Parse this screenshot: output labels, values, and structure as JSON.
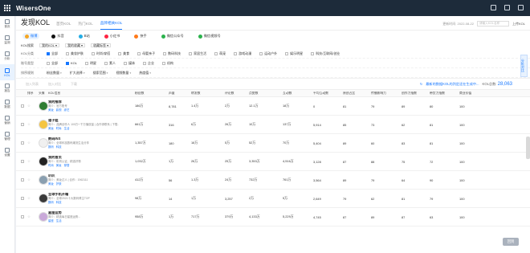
{
  "app": {
    "title": "WisersOne"
  },
  "sidebar": {
    "items": [
      {
        "label": "首页"
      },
      {
        "label": "监测"
      },
      {
        "label": "分析"
      },
      {
        "label": "KOL"
      },
      {
        "label": "报告"
      },
      {
        "label": "数据"
      },
      {
        "label": "营销"
      },
      {
        "label": "管理"
      },
      {
        "label": "设置"
      }
    ]
  },
  "header": {
    "title": "发现KOL",
    "tabs": [
      "首页KOL",
      "热门KOL",
      "品牌相关KOL"
    ],
    "updated": "更新时间: 2022-08-22",
    "search_placeholder": "请输入KOL名称",
    "export_label": "上传KOL"
  },
  "platforms": [
    "微博",
    "抖音",
    "B站",
    "小红书",
    "快手",
    "微信公众号",
    "微信视频号"
  ],
  "kol_row": {
    "label": "KOL搜索",
    "chips": [
      "我的KOL",
      "我的收藏",
      "收藏标签"
    ]
  },
  "filters": [
    {
      "label": "KOL分类",
      "options": [
        "全部",
        "美妆护肤",
        "时尚/穿搭",
        "美食",
        "母婴亲子",
        "数码科技",
        "家居生活",
        "萌宠",
        "游戏动漫",
        "运动户外",
        "娱乐明星",
        "科技/互联网/创业"
      ]
    },
    {
      "label": "账号类型",
      "options": [
        "全部",
        "KOL",
        "明星",
        "素人",
        "媒体",
        "企业",
        "机构"
      ]
    },
    {
      "label": "排序规则",
      "options": [
        "粉丝数量",
        "扩大选择",
        "搜索范围",
        "视频数量",
        "热度值"
      ]
    }
  ],
  "toolbar": {
    "actions": [
      "加入列表",
      "加入对比",
      "下载"
    ],
    "ai_label": "最新的数据KOL的判定还在生成中...",
    "count_label": "KOL总数:",
    "count": "28,063"
  },
  "table": {
    "headers": [
      "",
      "排序",
      "头像",
      "KOL信息",
      "粉丝数",
      "声量",
      "转发数",
      "评论数",
      "点赞数",
      "互动数",
      "平均互动数",
      "原创占比",
      "传播影响力",
      "创作力指数",
      "带货力指数",
      "商业价值"
    ],
    "rows": [
      {
        "name": "我的推荐",
        "desc": "简介：官方账号",
        "tags": [
          "美妆",
          "影视",
          "综艺"
        ],
        "fans": "186万",
        "vol": "8,781",
        "rt": "1.4万",
        "cm": "2万",
        "lk": "12.1万",
        "it": "18万",
        "avg": "0",
        "orig": "81",
        "spread": "79",
        "create": "89",
        "sell": "80",
        "biz": "100",
        "color": "#2e7d32"
      },
      {
        "name": "道子姐",
        "desc": "简介：品牌创作人 100万+ 千万播放量 | 合作请联系 | 下载...",
        "tags": [
          "美妆",
          "时尚",
          "生活"
        ],
        "fans": "661万",
        "vol": "316",
        "rt": "6万",
        "cm": "26万",
        "lk": "10万",
        "it": "137万",
        "avg": "5,914",
        "orig": "85",
        "spread": "73",
        "create": "62",
        "sell": "81",
        "biz": "100",
        "color": "#f5c542"
      },
      {
        "name": "数码INS",
        "desc": "简介：全球科技数码潮流生活分享",
        "tags": [
          "数码",
          "科技"
        ],
        "fans": "1,357万",
        "vol": "180",
        "rt": "16万",
        "cm": "5万",
        "lk": "52万",
        "it": "70万",
        "avg": "5,404",
        "orig": "89",
        "spread": "60",
        "create": "83",
        "sell": "81",
        "biz": "100",
        "color": "#f0f0f0"
      },
      {
        "name": "我的首页",
        "desc": "简介：机构认证，精选好物",
        "tags": [
          "时尚",
          "美妆",
          "穿搭"
        ],
        "fans": "1,032万",
        "vol": "1万",
        "rt": "26万",
        "cm": "25万",
        "lk": "3,353万",
        "it": "4,516万",
        "avg": "3,128",
        "orig": "87",
        "spread": "88",
        "create": "75",
        "sell": "72",
        "biz": "100",
        "color": "#222222"
      },
      {
        "name": "叭叭",
        "desc": "简介：美妆达人 | 合作：1962111",
        "tags": [
          "美妆",
          "护肤"
        ],
        "fans": "412万",
        "vol": "56",
        "rt": "1.3万",
        "cm": "24万",
        "lk": "732万",
        "it": "761万",
        "avg": "3,564",
        "orig": "89",
        "spread": "79",
        "create": "64",
        "sell": "90",
        "biz": "100",
        "color": "#8a9fb0"
      },
      {
        "name": "全球手机开箱",
        "desc": "简介：全球2021十大数码博主TOP",
        "tags": [
          "数码",
          "科技"
        ],
        "fans": "98万",
        "vol": "14",
        "rt": "1万",
        "cm": "3,257",
        "lk": "2万",
        "it": "5万",
        "avg": "2,649",
        "orig": "79",
        "spread": "62",
        "create": "81",
        "sell": "79",
        "biz": "100",
        "color": "#3a3a3a"
      },
      {
        "name": "星座运势",
        "desc": "简介：精选每日星座运势...",
        "tags": [
          "星座",
          "生活"
        ],
        "fans": "958万",
        "vol": "1万",
        "rt": "717万",
        "cm": "379万",
        "lk": "4,133万",
        "it": "5,229万",
        "avg": "4,745",
        "orig": "87",
        "spread": "89",
        "create": "87",
        "sell": "63",
        "biz": "100",
        "color": "#c9a9d9"
      }
    ]
  },
  "float_btn": "分析对比",
  "page_btn": "回到"
}
